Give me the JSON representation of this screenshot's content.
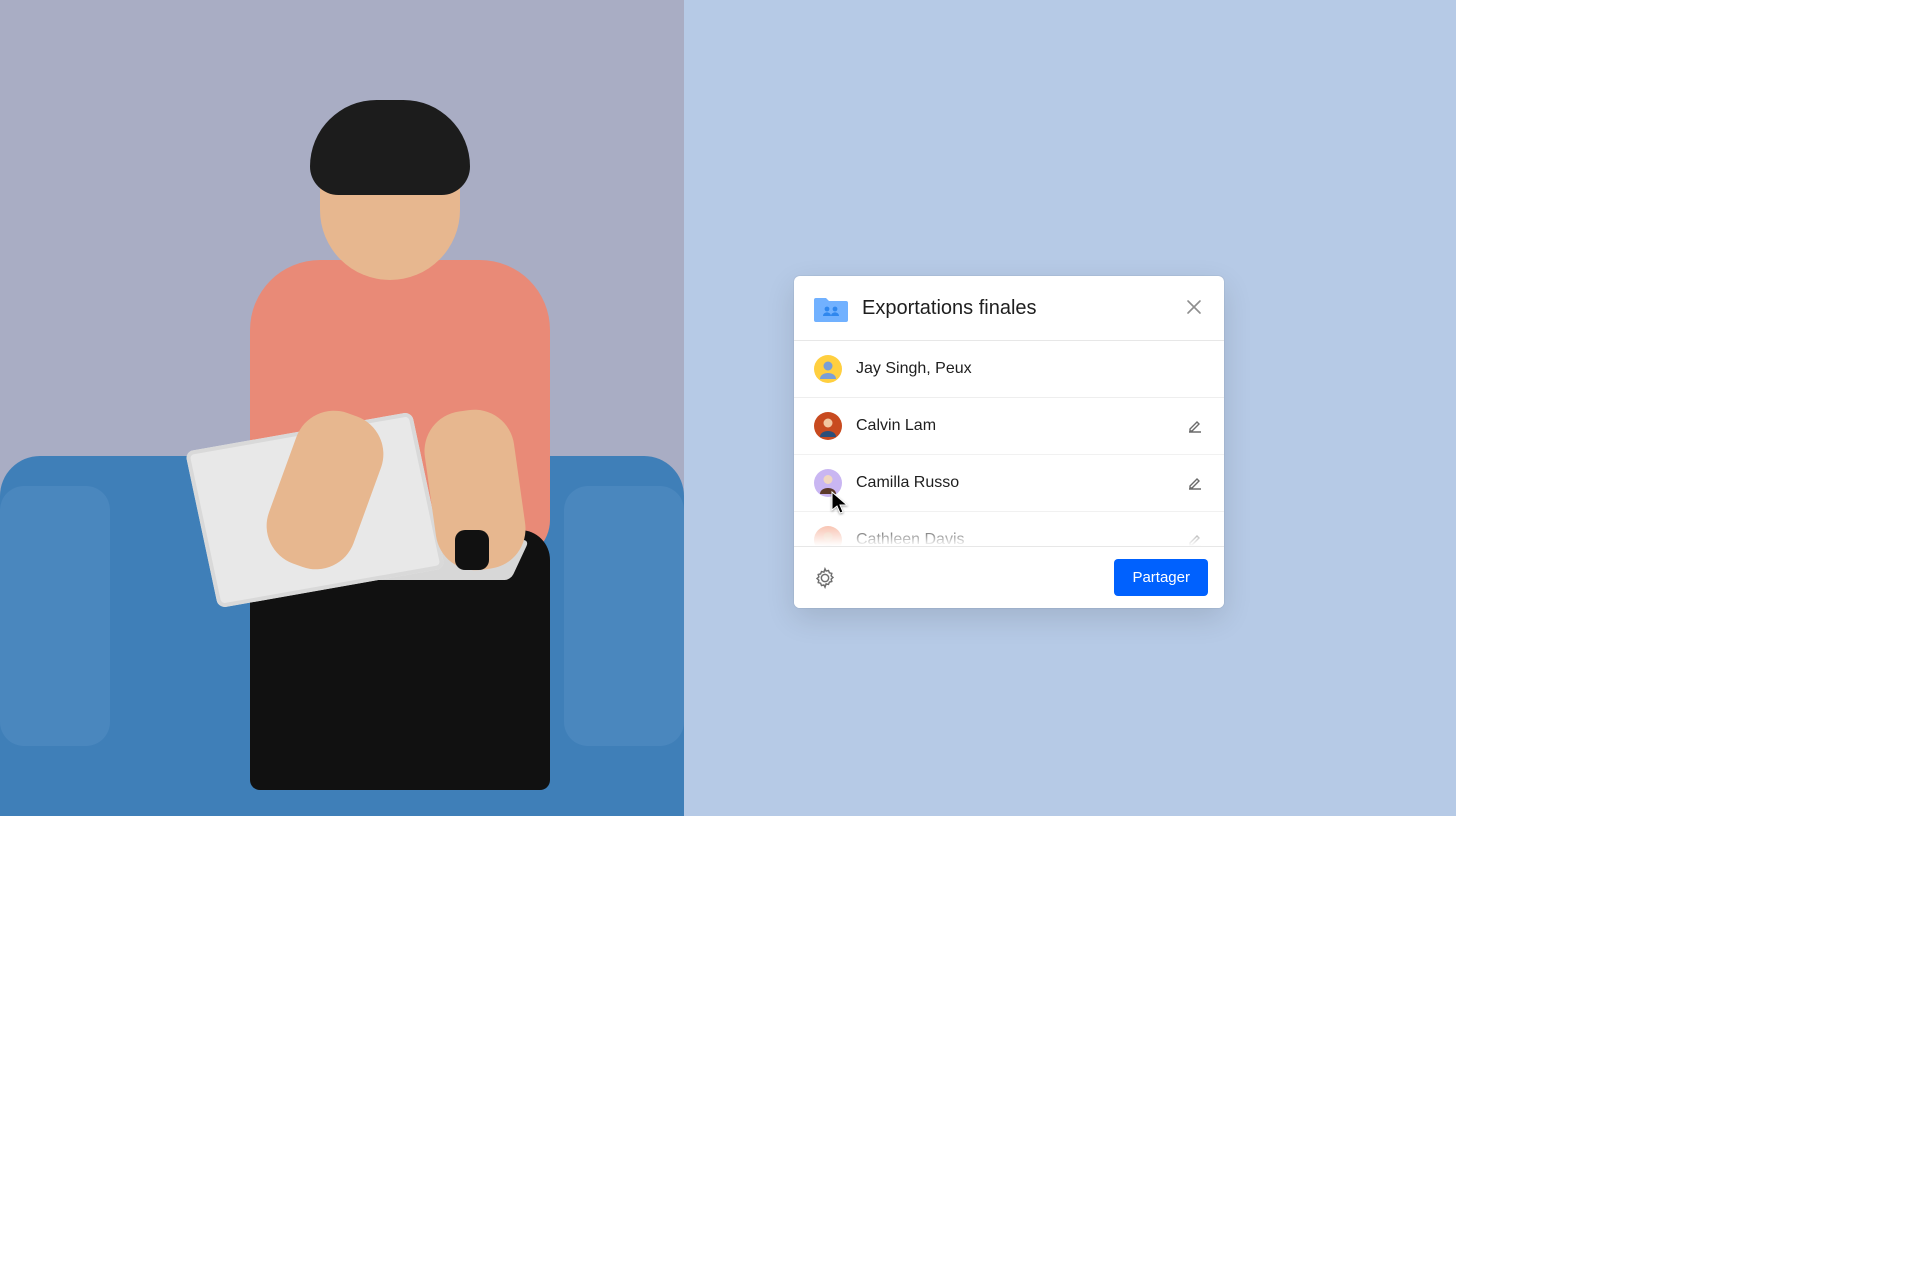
{
  "dialog": {
    "title": "Exportations finales",
    "input_value": "Jay Singh, Peux",
    "share_button": "Partager"
  },
  "avatars": {
    "input": {
      "bg": "#ffcf3f"
    },
    "people": [
      {
        "bg": "#c84a1f"
      },
      {
        "bg": "#c9b6f2"
      },
      {
        "bg": "#f7b9a4"
      }
    ]
  },
  "people": [
    {
      "name": "Calvin Lam"
    },
    {
      "name": "Camilla Russo"
    },
    {
      "name": "Cathleen Davis"
    }
  ],
  "colors": {
    "primary": "#0061fe",
    "right_bg": "#b6cae6"
  }
}
